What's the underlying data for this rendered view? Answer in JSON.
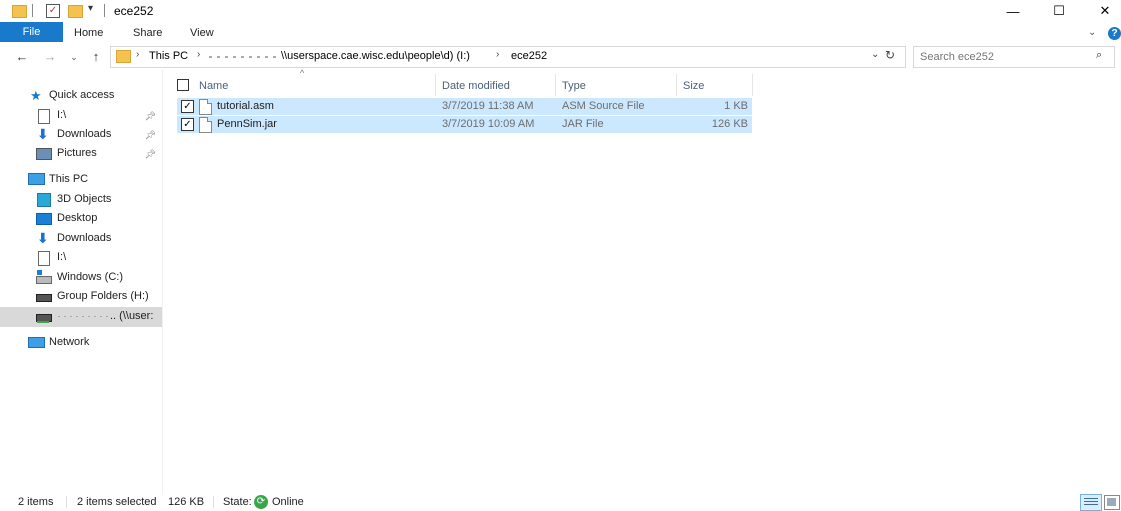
{
  "window": {
    "title": "ece252",
    "minimize": "—",
    "maximize": "☐",
    "close": "✕"
  },
  "ribbon": {
    "file": "File",
    "tabs": [
      "Home",
      "Share",
      "View"
    ]
  },
  "address": {
    "crumbs": [
      "This PC",
      "\\\\userspace.cae.wisc.edu\\people\\d) (I:)",
      "ece252"
    ]
  },
  "search": {
    "placeholder": "Search ece252"
  },
  "nav": {
    "quick_access": "Quick access",
    "quick_items": [
      "I:\\",
      "Downloads",
      "Pictures"
    ],
    "this_pc": "This PC",
    "pc_items": [
      "3D Objects",
      "Desktop",
      "Downloads",
      "I:\\",
      "Windows (C:)",
      "Group Folders (H:)",
      ".. (\\\\user:"
    ],
    "network": "Network"
  },
  "columns": [
    "Name",
    "Date modified",
    "Type",
    "Size"
  ],
  "files": [
    {
      "name": "tutorial.asm",
      "date": "3/7/2019 11:38 AM",
      "type": "ASM Source File",
      "size": "1 KB"
    },
    {
      "name": "PennSim.jar",
      "date": "3/7/2019 10:09 AM",
      "type": "JAR File",
      "size": "126 KB"
    }
  ],
  "status": {
    "items": "2 items",
    "selected": "2 items selected",
    "size": "126 KB",
    "state_label": "State:",
    "state_value": "Online"
  },
  "colors": {
    "accent": "#1979ca",
    "selection": "#cce8ff",
    "online": "#3aa64c"
  }
}
